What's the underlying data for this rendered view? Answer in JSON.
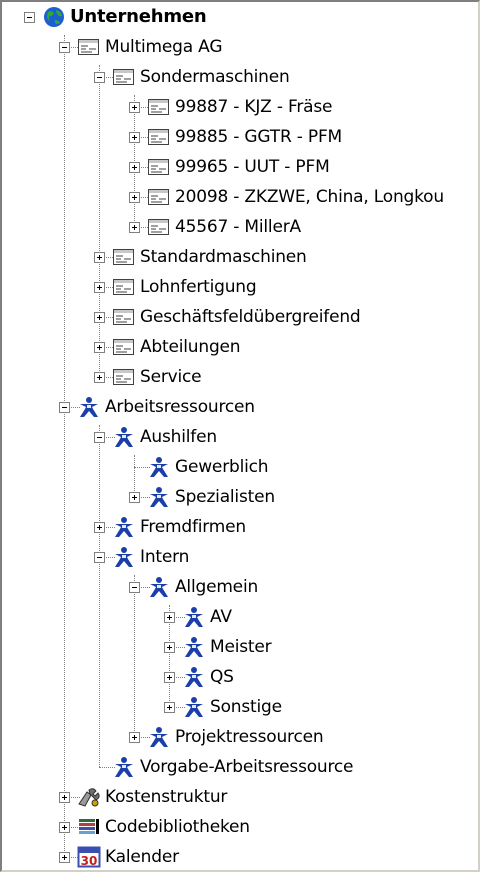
{
  "tree": {
    "root": "Unternehmen",
    "multimega": "Multimega AG",
    "sondermaschinen": "Sondermaschinen",
    "sm_items": [
      "99887 - KJZ - Fräse",
      "99885 - GGTR - PFM",
      "99965 - UUT - PFM",
      "20098 - ZKZWE, China, Longkou",
      "45567 - MillerA"
    ],
    "mm_items": [
      "Standardmaschinen",
      "Lohnfertigung",
      "Geschäftsfeldübergreifend",
      "Abteilungen",
      "Service"
    ],
    "arbeitsressourcen": "Arbeitsressourcen",
    "aushilfen": "Aushilfen",
    "gewerblich": "Gewerblich",
    "spezialisten": "Spezialisten",
    "fremdfirmen": "Fremdfirmen",
    "intern": "Intern",
    "allgemein": "Allgemein",
    "allgemein_items": [
      "AV",
      "Meister",
      "QS",
      "Sonstige"
    ],
    "projektressourcen": "Projektressourcen",
    "vorgabe": "Vorgabe-Arbeitsressource",
    "kostenstruktur": "Kostenstruktur",
    "codebibliotheken": "Codebibliotheken",
    "kalender": "Kalender",
    "kalender_icon_text": "30"
  },
  "colors": {
    "connector": "#808080",
    "person_icon": "#1a3fa8",
    "globe": "#1e5fd0",
    "calendar": "#3a4fb0"
  },
  "icons": {
    "root": "globe-icon",
    "folder": "list-icon",
    "resource": "person-icon",
    "cost": "tools-icon",
    "code": "code-library-icon",
    "calendar": "calendar-icon"
  }
}
